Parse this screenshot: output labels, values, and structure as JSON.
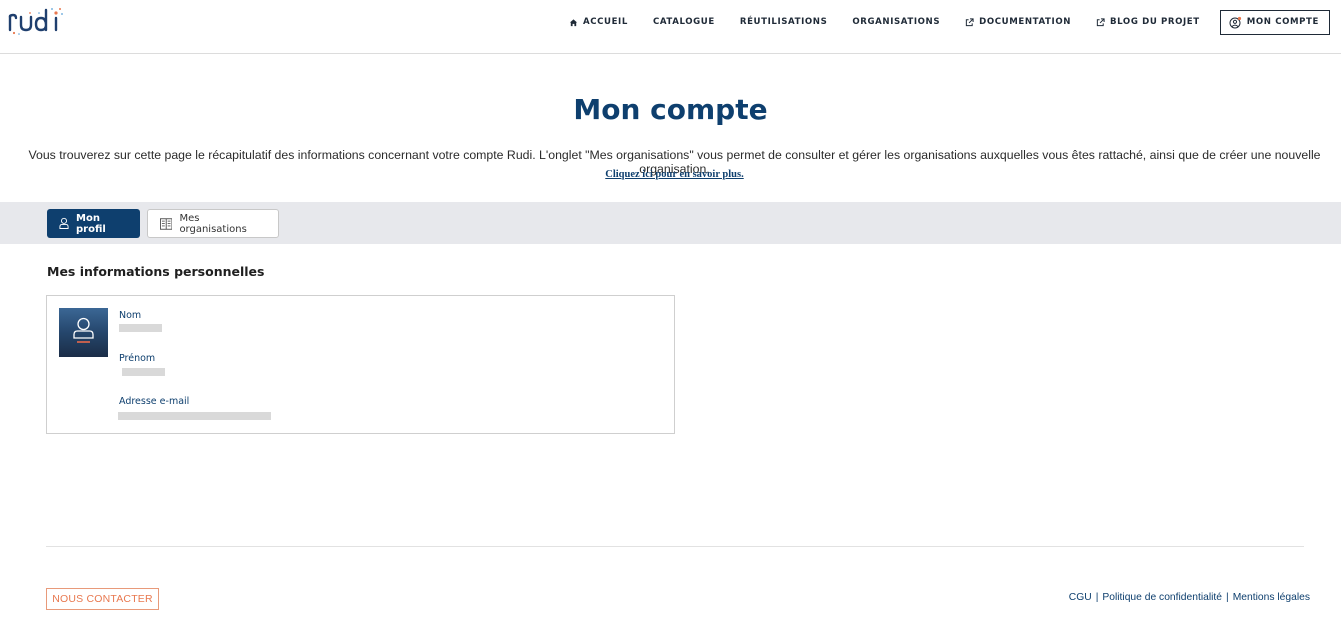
{
  "brand": {
    "logo_text": "rudi",
    "logo_color": "#1f3f6e",
    "accent_orange": "#e8784f"
  },
  "nav": {
    "items": [
      {
        "label": "ACCUEIL",
        "icon": "home-icon"
      },
      {
        "label": "CATALOGUE"
      },
      {
        "label": "RÉUTILISATIONS"
      },
      {
        "label": "ORGANISATIONS"
      },
      {
        "label": "DOCUMENTATION",
        "icon": "external-link-icon"
      },
      {
        "label": "BLOG DU PROJET",
        "icon": "external-link-icon"
      }
    ],
    "account_label": "MON COMPTE",
    "account_icon": "user-account-icon"
  },
  "page": {
    "title": "Mon compte",
    "intro": "Vous trouverez sur cette page le récapitulatif des informations concernant votre compte Rudi. L'onglet \"Mes organisations\" vous permet de consulter et gérer les organisations auxquelles vous êtes rattaché, ainsi que de créer une nouvelle organisation.",
    "more_link": "Cliquez ici pour en savoir plus."
  },
  "tabs": [
    {
      "label": "Mon profil",
      "icon": "user-icon",
      "active": true
    },
    {
      "label": "Mes organisations",
      "icon": "building-icon",
      "active": false
    }
  ],
  "profile": {
    "section_title": "Mes informations personnelles",
    "fields": [
      {
        "label": "Nom"
      },
      {
        "label": "Prénom"
      },
      {
        "label": "Adresse e-mail"
      }
    ]
  },
  "footer": {
    "contact_label": "NOUS CONTACTER",
    "links": [
      "CGU",
      "Politique de confidentialité",
      "Mentions légales"
    ],
    "separator": "|"
  }
}
